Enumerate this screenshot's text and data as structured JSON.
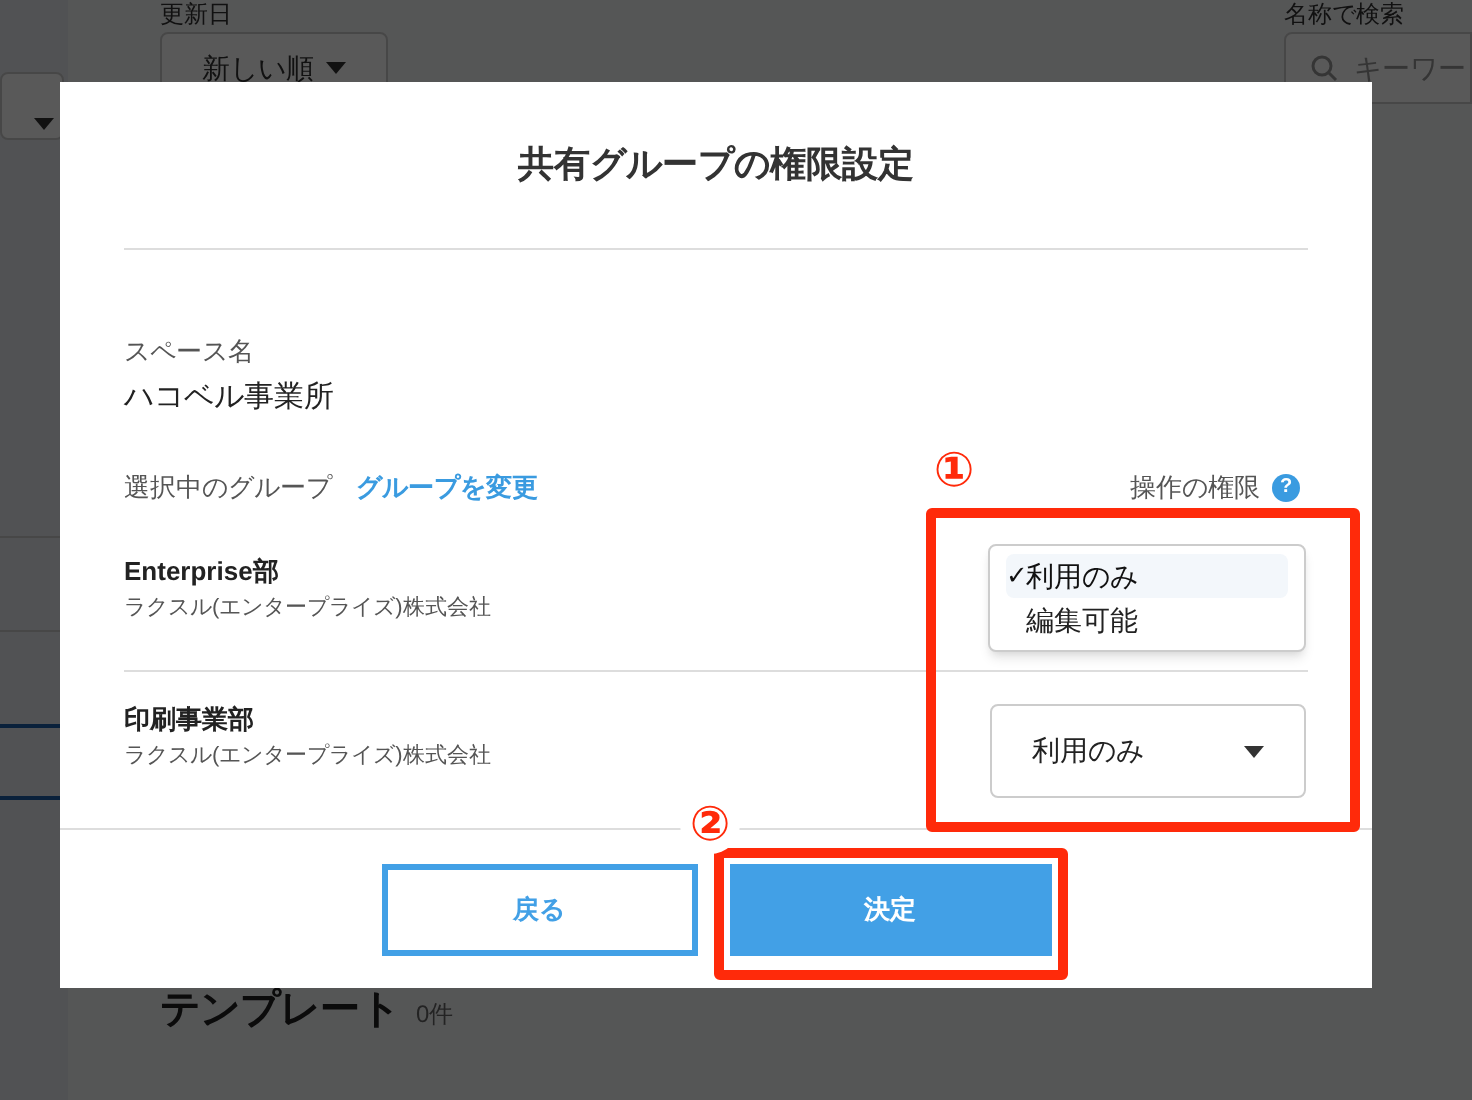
{
  "background": {
    "sort_label": "更新日",
    "sort_value": "新しい順",
    "search_label": "名称で検索",
    "search_placeholder": "キーワー",
    "section_title": "テンプレート",
    "section_count": "0件"
  },
  "dialog": {
    "title": "共有グループの権限設定",
    "space_label": "スペース名",
    "space_name": "ハコベル事業所",
    "group_label": "選択中のグループ",
    "change_link": "グループを変更",
    "permission_label": "操作の権限",
    "help": "?",
    "check": "✓",
    "groups": [
      {
        "name": "Enterprise部",
        "company": "ラクスル(エンタープライズ)株式会社",
        "expanded": true,
        "options": [
          {
            "label": "利用のみ",
            "selected": true
          },
          {
            "label": "編集可能",
            "selected": false
          }
        ]
      },
      {
        "name": "印刷事業部",
        "company": "ラクスル(エンタープライズ)株式会社",
        "expanded": false,
        "value": "利用のみ"
      }
    ],
    "buttons": [
      {
        "label": "戻る",
        "kind": "secondary"
      },
      {
        "label": "決定",
        "kind": "primary"
      }
    ]
  },
  "annotations": [
    {
      "label": "①"
    },
    {
      "label": "②"
    }
  ]
}
